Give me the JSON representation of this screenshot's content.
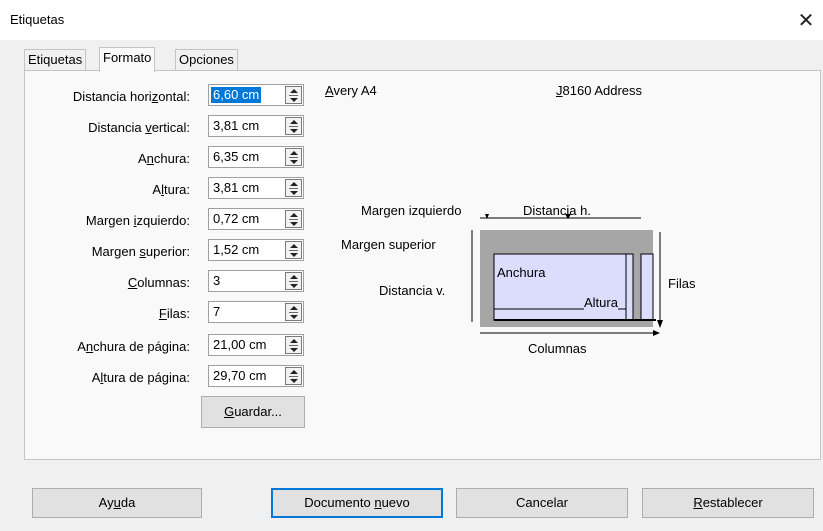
{
  "window": {
    "title": "Etiquetas",
    "close_glyph": "✕"
  },
  "tabs": [
    {
      "label": "Etiquetas",
      "active": false
    },
    {
      "label": "Formato",
      "active": true
    },
    {
      "label": "Opciones",
      "active": false
    }
  ],
  "form": {
    "horizontal": {
      "pre": "Distancia hori",
      "u": "z",
      "post": "ontal:",
      "value": "6,60 cm"
    },
    "vertical": {
      "pre": "Distancia ",
      "u": "v",
      "post": "ertical:",
      "value": "3,81 cm"
    },
    "width": {
      "pre": "A",
      "u": "n",
      "post": "chura:",
      "value": "6,35 cm"
    },
    "height": {
      "pre": "A",
      "u": "l",
      "post": "tura:",
      "value": "3,81 cm"
    },
    "left_margin": {
      "pre": "Margen ",
      "u": "i",
      "post": "zquierdo:",
      "value": "0,72 cm"
    },
    "top_margin": {
      "pre": "Margen ",
      "u": "s",
      "post": "uperior:",
      "value": "1,52 cm"
    },
    "columns": {
      "pre": "",
      "u": "C",
      "post": "olumnas:",
      "value": "3"
    },
    "rows": {
      "pre": "",
      "u": "F",
      "post": "ilas:",
      "value": "7"
    },
    "page_width": {
      "pre": "A",
      "u": "n",
      "post": "chura de página:",
      "value": "21,00 cm"
    },
    "page_height": {
      "pre": "A",
      "u": "l",
      "post": "tura de página:",
      "value": "29,70 cm"
    }
  },
  "save_button": {
    "pre": "",
    "u": "G",
    "post": "uardar..."
  },
  "label_info": {
    "brand_u": "A",
    "brand_rest": "very A4",
    "product_u": "J",
    "product_rest": "8160 Address"
  },
  "diagram": {
    "left_margin": "Margen izquierdo",
    "h_distance": "Distancia h.",
    "top_margin": "Margen superior",
    "v_distance": "Distancia v.",
    "width": "Anchura",
    "height": "Altura",
    "rows": "Filas",
    "columns": "Columnas"
  },
  "footer": {
    "help": {
      "pre": "Ay",
      "u": "u",
      "post": "da"
    },
    "new_document": {
      "pre": "Documento ",
      "u": "n",
      "post": "uevo"
    },
    "cancel": {
      "pre": "Cancelar",
      "u": "",
      "post": ""
    },
    "reset": {
      "pre": "",
      "u": "R",
      "post": "establecer"
    }
  }
}
